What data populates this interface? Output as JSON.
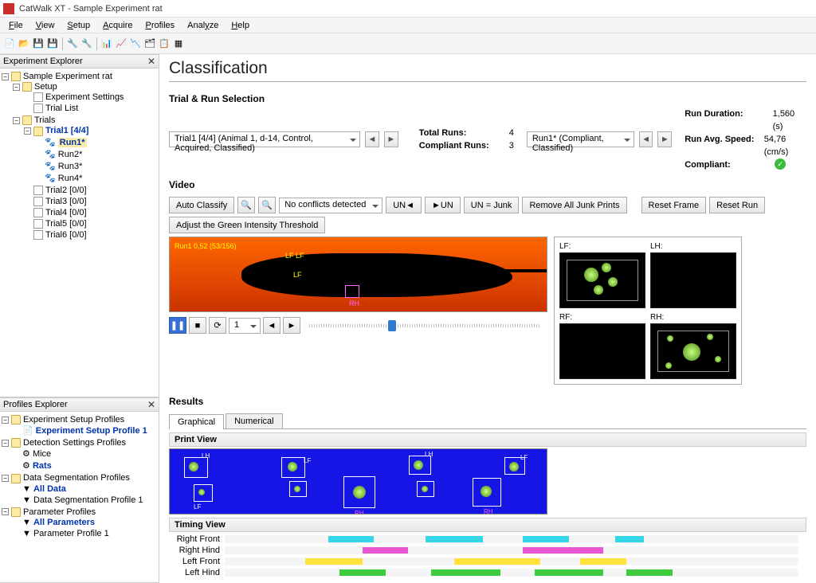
{
  "titlebar": {
    "text": "CatWalk XT - Sample Experiment rat"
  },
  "menu": {
    "file": "File",
    "view": "View",
    "setup": "Setup",
    "acquire": "Acquire",
    "profiles": "Profiles",
    "analyze": "Analyze",
    "help": "Help"
  },
  "explorer": {
    "title": "Experiment Explorer",
    "root": "Sample Experiment rat",
    "setup": "Setup",
    "exp_settings": "Experiment Settings",
    "trial_list": "Trial List",
    "trials": "Trials",
    "trial1": "Trial1 [4/4]",
    "run1": "Run1*",
    "run2": "Run2*",
    "run3": "Run3*",
    "run4": "Run4*",
    "trial2": "Trial2 [0/0]",
    "trial3": "Trial3 [0/0]",
    "trial4": "Trial4 [0/0]",
    "trial5": "Trial5 [0/0]",
    "trial6": "Trial6 [0/0]"
  },
  "profiles": {
    "title": "Profiles Explorer",
    "esp": "Experiment Setup Profiles",
    "esp1": "Experiment Setup Profile 1",
    "dsp": "Detection Settings Profiles",
    "mice": "Mice",
    "rats": "Rats",
    "dsegp": "Data Segmentation Profiles",
    "alldata": "All Data",
    "dseg1": "Data Segmentation Profile 1",
    "pp": "Parameter Profiles",
    "allparam": "All Parameters",
    "pp1": "Parameter Profile 1"
  },
  "page": {
    "title": "Classification",
    "trial_sel_hdr": "Trial & Run Selection",
    "trial_dd": "Trial1 [4/4] (Animal 1, d-14, Control, Acquired, Classified)",
    "run_dd": "Run1* (Compliant, Classified)",
    "total_runs_label": "Total Runs:",
    "total_runs": "4",
    "compliant_runs_label": "Compliant Runs:",
    "compliant_runs": "3",
    "run_duration_label": "Run Duration:",
    "run_duration": "1,560 (s)",
    "run_speed_label": "Run Avg. Speed:",
    "run_speed": "54,76 (cm/s)",
    "compliant_label": "Compliant:",
    "video_hdr": "Video",
    "auto_classify": "Auto Classify",
    "conflicts": "No conflicts detected",
    "un_left": "UN",
    "un_right": "UN",
    "un_junk": "UN = Junk",
    "remove_junk": "Remove All Junk Prints",
    "reset_frame": "Reset Frame",
    "reset_run": "Reset Run",
    "adjust_green": "Adjust the Green Intensity Threshold",
    "overlay": "Run1 0,52 (53/156)",
    "playback_frame": "1",
    "paw_lf": "LF:",
    "paw_lh": "LH:",
    "paw_rf": "RF:",
    "paw_rh": "RH:",
    "results_hdr": "Results",
    "tab_graphical": "Graphical",
    "tab_numerical": "Numerical",
    "print_view_hdr": "Print View",
    "timing_view_hdr": "Timing View",
    "tv_rf": "Right Front",
    "tv_rh": "Right Hind",
    "tv_lf": "Left Front",
    "tv_lh": "Left Hind"
  },
  "chart_data": {
    "type": "table",
    "title": "Timing View (stance bars, approx % of run width)",
    "rows": [
      {
        "name": "Right Front",
        "color": "cyan",
        "bars": [
          [
            18,
            8
          ],
          [
            35,
            10
          ],
          [
            52,
            8
          ],
          [
            68,
            5
          ]
        ]
      },
      {
        "name": "Right Hind",
        "color": "magenta",
        "bars": [
          [
            24,
            8
          ],
          [
            52,
            14
          ]
        ]
      },
      {
        "name": "Left Front",
        "color": "yellow",
        "bars": [
          [
            14,
            10
          ],
          [
            40,
            15
          ],
          [
            62,
            8
          ]
        ]
      },
      {
        "name": "Left Hind",
        "color": "green",
        "bars": [
          [
            20,
            8
          ],
          [
            36,
            12
          ],
          [
            54,
            12
          ],
          [
            70,
            8
          ]
        ]
      }
    ]
  }
}
